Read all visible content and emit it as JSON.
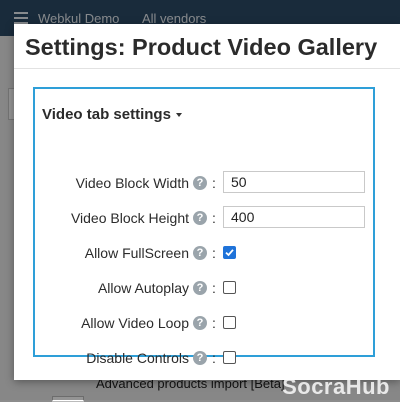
{
  "background": {
    "company": "Webkul Demo",
    "vendors": "All vendors",
    "link": "Advanced products import [Beta]"
  },
  "modal": {
    "title": "Settings: Product Video Gallery",
    "panel": {
      "title": "Video tab settings",
      "fields": {
        "video_block_width": {
          "label": "Video Block Width",
          "value": "50"
        },
        "video_block_height": {
          "label": "Video Block Height",
          "value": "400"
        },
        "allow_fullscreen": {
          "label": "Allow FullScreen",
          "checked": true
        },
        "allow_autoplay": {
          "label": "Allow Autoplay",
          "checked": false
        },
        "allow_video_loop": {
          "label": "Allow Video Loop",
          "checked": false
        },
        "disable_controls": {
          "label": "Disable Controls",
          "checked": false
        }
      },
      "help_glyph": "?",
      "colon": ":"
    }
  },
  "watermark": "SocraHub",
  "colors": {
    "accent_border": "#2e9fd8",
    "checkbox_checked": "#1f73d9",
    "topbar": "#2c4a66"
  },
  "icons": {
    "help": "question-circle-icon",
    "dropdown": "caret-down-icon",
    "menu": "hamburger-icon"
  }
}
